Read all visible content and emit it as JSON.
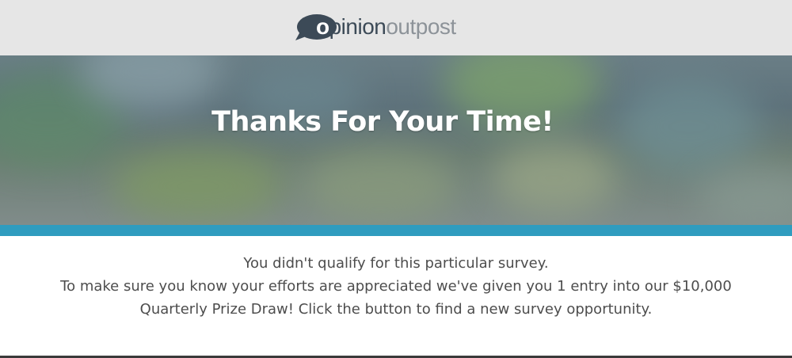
{
  "header": {
    "logo": {
      "letter_o": "o",
      "word_opinion": "pinion",
      "word_outpost": "outpost"
    }
  },
  "hero": {
    "title": "Thanks For Your Time!"
  },
  "message": {
    "line1": "You didn't qualify for this particular survey.",
    "line2": "To make sure you know your efforts are appreciated we've given you 1 entry into our $10,000",
    "line3": "Quarterly Prize Draw! Click the button to find a new survey opportunity."
  },
  "colors": {
    "header_bg": "#e6e6e6",
    "logo_dark": "#3c4a57",
    "logo_light": "#8d9399",
    "accent": "#2f9cbf",
    "body_text": "#4d4d4d"
  }
}
